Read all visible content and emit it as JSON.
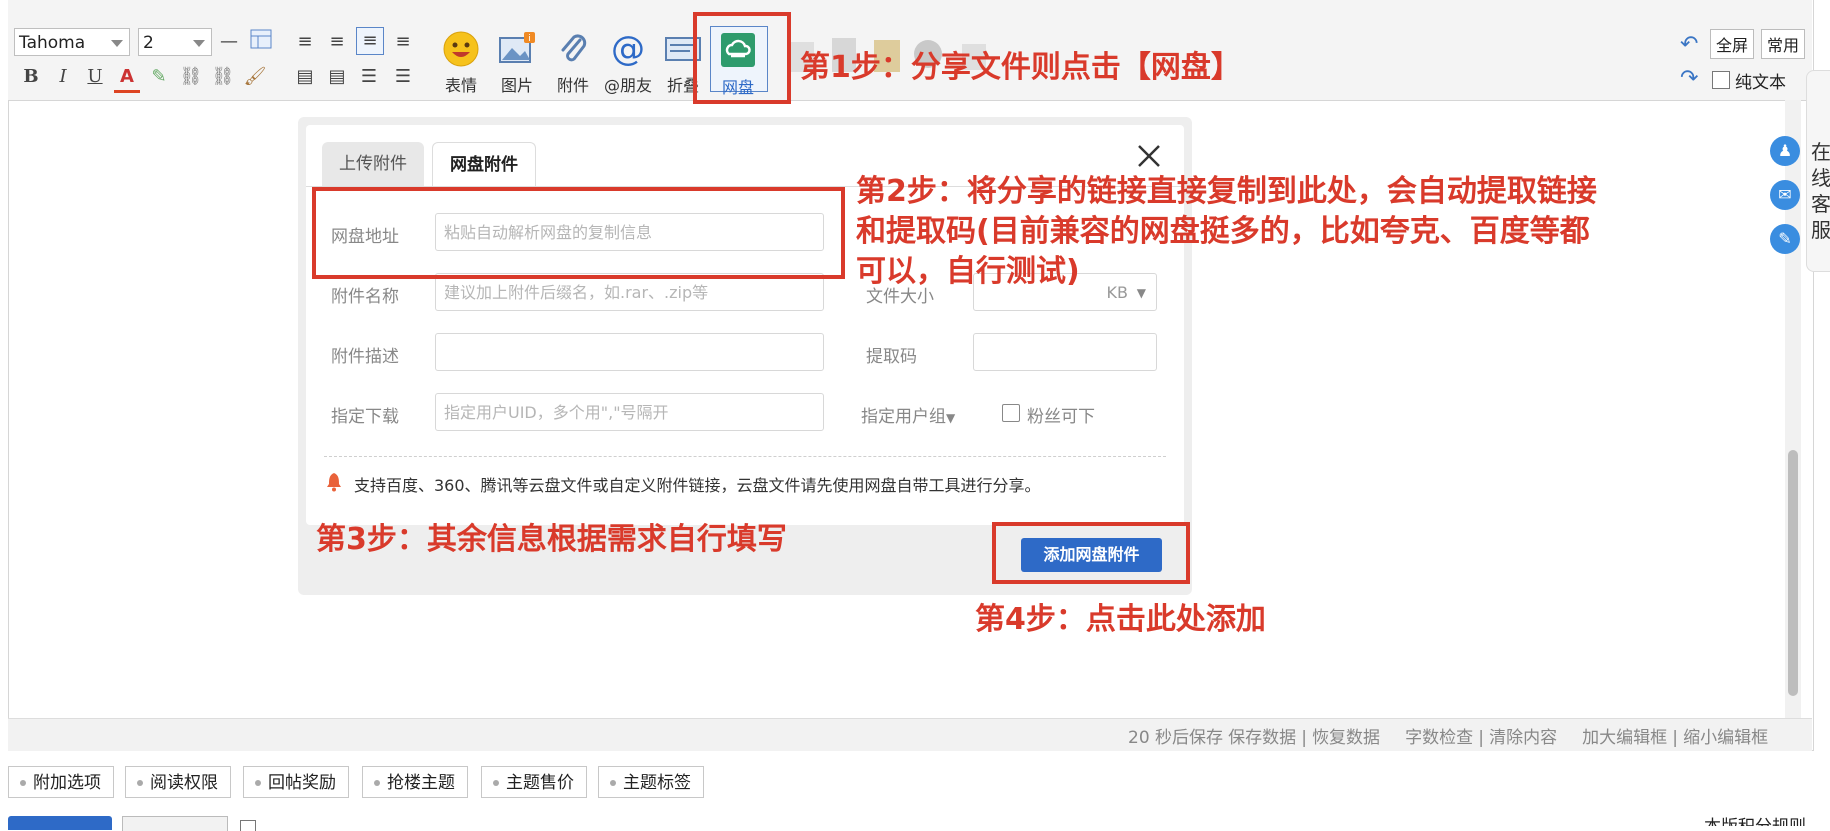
{
  "toolbar": {
    "font_family": "Tahoma",
    "font_size": "2",
    "big_buttons": [
      "表情",
      "图片",
      "附件",
      "@朋友",
      "折叠",
      "网盘"
    ],
    "fullscreen_label": "全屏",
    "common_label": "常用",
    "plain_text_label": "纯文本"
  },
  "dialog": {
    "tabs": [
      "上传附件",
      "网盘附件"
    ],
    "fields": {
      "pan_url_label": "网盘地址",
      "pan_url_placeholder": "粘贴自动解析网盘的复制信息",
      "name_label": "附件名称",
      "name_placeholder": "建议加上附件后缀名，如.rar、.zip等",
      "size_label": "文件大小",
      "size_unit": "KB",
      "desc_label": "附件描述",
      "code_label": "提取码",
      "download_label": "指定下载",
      "download_placeholder": "指定用户UID，多个用\",\"号隔开",
      "group_label": "指定用户组",
      "fans_label": "粉丝可下"
    },
    "notice": "支持百度、360、腾讯等云盘文件或自定义附件链接，云盘文件请先使用网盘自带工具进行分享。",
    "add_button": "添加网盘附件"
  },
  "annotations": {
    "step1": "第1步：分享文件则点击【网盘】",
    "step2_line1": "第2步：将分享的链接直接复制到此处，会自动提取链接",
    "step2_line2": "和提取码(目前兼容的网盘挺多的，比如夸克、百度等都",
    "step2_line3": "可以，自行测试)",
    "step3": "第3步：其余信息根据需求自行填写",
    "step4": "第4步：点击此处添加"
  },
  "statusbar": {
    "autosave": "20 秒后保存",
    "save": "保存数据",
    "restore": "恢复数据",
    "wordcount": "字数检查",
    "clear": "清除内容",
    "enlarge": "加大编辑框",
    "shrink": "缩小编辑框"
  },
  "options": [
    "附加选项",
    "阅读权限",
    "回帖奖励",
    "抢楼主题",
    "主题售价",
    "主题标签"
  ],
  "right_edge": {
    "side_text": "在线客服",
    "bottom_text": "本版积分规则"
  },
  "colors": {
    "annotation_red": "#d93a2b",
    "primary_blue": "#2e6ac7",
    "pan_green": "#2e9b6d"
  }
}
